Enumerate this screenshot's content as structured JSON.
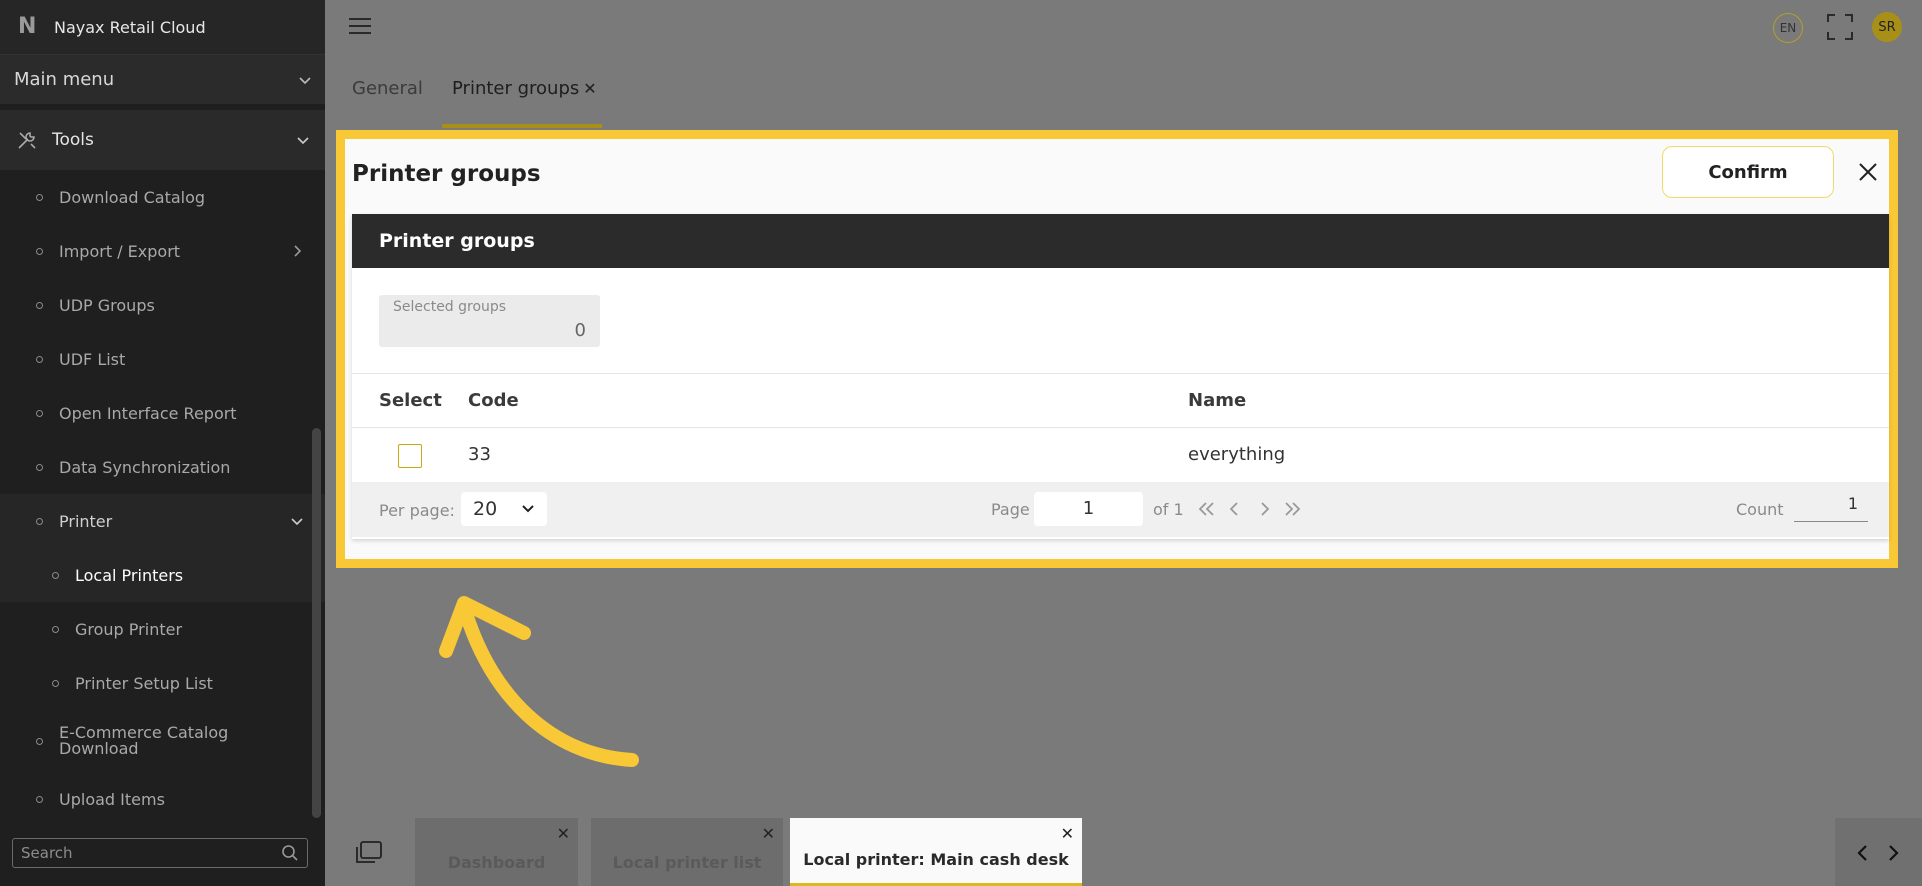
{
  "app": {
    "name": "Nayax Retail Cloud"
  },
  "sidebar": {
    "main_menu_label": "Main menu",
    "section_label": "Tools",
    "items": [
      {
        "label": "Download Catalog"
      },
      {
        "label": "Import / Export"
      },
      {
        "label": "UDP Groups"
      },
      {
        "label": "UDF List"
      },
      {
        "label": "Open Interface Report"
      },
      {
        "label": "Data Synchronization"
      },
      {
        "label": "Printer"
      },
      {
        "label": "Local Printers"
      },
      {
        "label": "Group Printer"
      },
      {
        "label": "Printer Setup List"
      },
      {
        "label": "E-Commerce Catalog Download"
      },
      {
        "label": "Upload Items"
      }
    ],
    "search_placeholder": "Search"
  },
  "header": {
    "language": "EN",
    "avatar_initials": "SR"
  },
  "tabs": [
    {
      "label": "General"
    },
    {
      "label": "Printer groups"
    }
  ],
  "modal": {
    "title": "Printer groups",
    "confirm_label": "Confirm",
    "panel_title": "Printer groups",
    "selected_groups_label": "Selected groups",
    "selected_groups_value": "0",
    "table": {
      "columns": {
        "select": "Select",
        "code": "Code",
        "name": "Name"
      },
      "rows": [
        {
          "code": "33",
          "name": "everything"
        }
      ]
    },
    "pager": {
      "per_page_label": "Per page:",
      "per_page_value": "20",
      "page_label": "Page",
      "page_value": "1",
      "of_label": "of 1",
      "count_label": "Count",
      "count_value": "1"
    }
  },
  "bottom_tabs": [
    {
      "label": "Dashboard"
    },
    {
      "label": "Local printer list"
    },
    {
      "label": "Local printer: Main cash desk"
    }
  ],
  "colors": {
    "accent": "#f8c836",
    "gold": "#a89018",
    "sidebar_bg": "#1f1f1f"
  }
}
